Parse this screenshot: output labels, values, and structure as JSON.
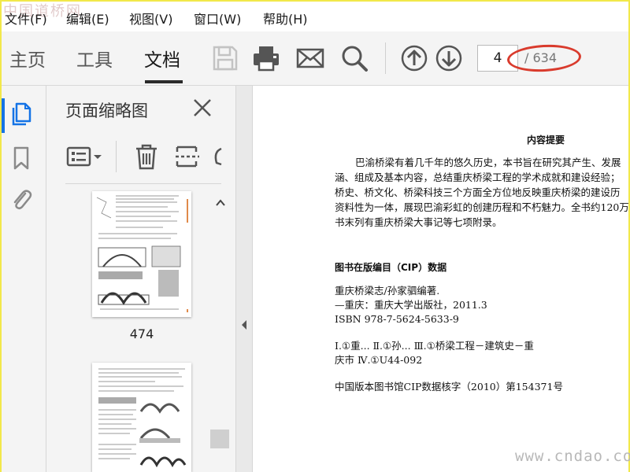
{
  "watermark_top": "中国道桥网",
  "watermark_bottom": "www.cndao.com",
  "menu": {
    "items": [
      {
        "label": "文件(F)"
      },
      {
        "label": "编辑(E)"
      },
      {
        "label": "视图(V)"
      },
      {
        "label": "窗口(W)"
      },
      {
        "label": "帮助(H)"
      }
    ]
  },
  "toolbar": {
    "tabs": [
      {
        "label": "主页"
      },
      {
        "label": "工具"
      },
      {
        "label": "文档"
      }
    ],
    "active_tab": "文档",
    "icons": [
      "save-icon",
      "print-icon",
      "email-icon",
      "search-icon",
      "previous-page-icon",
      "next-page-icon"
    ],
    "page_current": "4",
    "page_total": "/ 634",
    "annotation_color": "#d93b2d"
  },
  "rail": {
    "icons": [
      "page-thumbnails-icon",
      "bookmark-icon",
      "attachment-icon"
    ],
    "accent": "#1473e6"
  },
  "panel": {
    "title": "页面缩略图",
    "tool_icons": [
      "page-options-icon",
      "delete-icon",
      "extract-icon",
      "rotate-icon"
    ],
    "thumbnails": [
      {
        "page_label": "474"
      },
      {
        "page_label": ""
      }
    ]
  },
  "document": {
    "heading": "内容提要",
    "paragraph_lines": [
      "巴渝桥梁有着几千年的悠久历史，本书旨在研究其产生、发展",
      "涵、组成及基本内容，总结重庆桥梁工程的学术成就和建设经验；",
      "桥史、桥文化、桥梁科技三个方面全方位地反映重庆桥梁的建设历",
      "资料性为一体，展现巴渝彩虹的创建历程和不朽魅力。全书约120万",
      "书末列有重庆桥梁大事记等七项附录。"
    ],
    "cip_title": "图书在版编目（CIP）数据",
    "cip_lines": [
      "重庆桥梁志/孙家驷编著.",
      "—重庆：重庆大学出版社，2011.3",
      "ISBN  978-7-5624-5633-9"
    ],
    "classification_lines": [
      "Ⅰ.①重...  Ⅱ.①孙...  Ⅲ.①桥梁工程－建筑史－重",
      "庆市  Ⅳ.①U44-092"
    ],
    "cip_number": "中国版本图书馆CIP数据核字（2010）第154371号"
  }
}
